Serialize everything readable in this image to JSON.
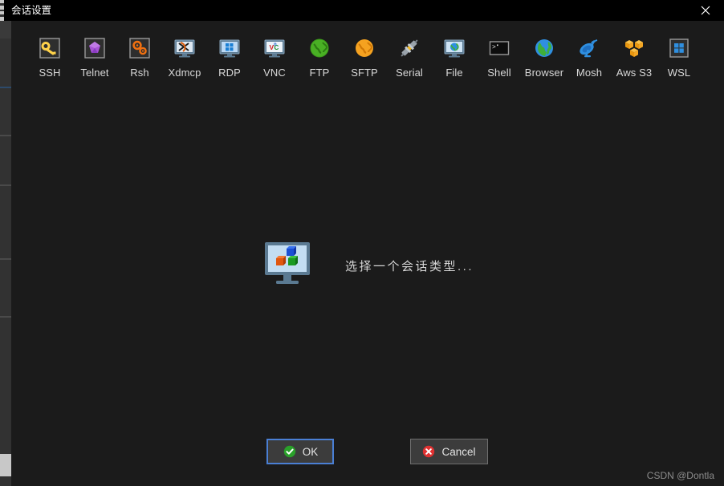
{
  "window": {
    "title": "会话设置",
    "close_label": "✕",
    "close_icon": "close-icon"
  },
  "session_types": [
    {
      "label": "SSH",
      "icon": "ssh-key-icon"
    },
    {
      "label": "Telnet",
      "icon": "telnet-gem-icon"
    },
    {
      "label": "Rsh",
      "icon": "rsh-gears-icon"
    },
    {
      "label": "Xdmcp",
      "icon": "xdmcp-monitor-icon"
    },
    {
      "label": "RDP",
      "icon": "rdp-windows-monitor-icon"
    },
    {
      "label": "VNC",
      "icon": "vnc-monitor-icon"
    },
    {
      "label": "FTP",
      "icon": "ftp-green-globe-icon"
    },
    {
      "label": "SFTP",
      "icon": "sftp-orange-globe-icon"
    },
    {
      "label": "Serial",
      "icon": "serial-connector-icon"
    },
    {
      "label": "File",
      "icon": "file-monitor-globe-icon"
    },
    {
      "label": "Shell",
      "icon": "shell-terminal-icon"
    },
    {
      "label": "Browser",
      "icon": "browser-globe-icon"
    },
    {
      "label": "Mosh",
      "icon": "mosh-satellite-icon"
    },
    {
      "label": "Aws S3",
      "icon": "aws-s3-cubes-icon"
    },
    {
      "label": "WSL",
      "icon": "wsl-windows-icon"
    }
  ],
  "placeholder": {
    "icon": "monitor-cubes-icon",
    "text": "选择一个会话类型..."
  },
  "buttons": {
    "ok": {
      "label": "OK",
      "icon": "check-circle-icon"
    },
    "cancel": {
      "label": "Cancel",
      "icon": "x-circle-icon"
    }
  },
  "watermark": "CSDN @Dontla",
  "colors": {
    "background": "#1b1b1b",
    "titlebar": "#000000",
    "accent_focus": "#4a7fd4",
    "ok_green": "#2aa02a",
    "cancel_red": "#e03131",
    "label_text": "#d8d8d8"
  }
}
